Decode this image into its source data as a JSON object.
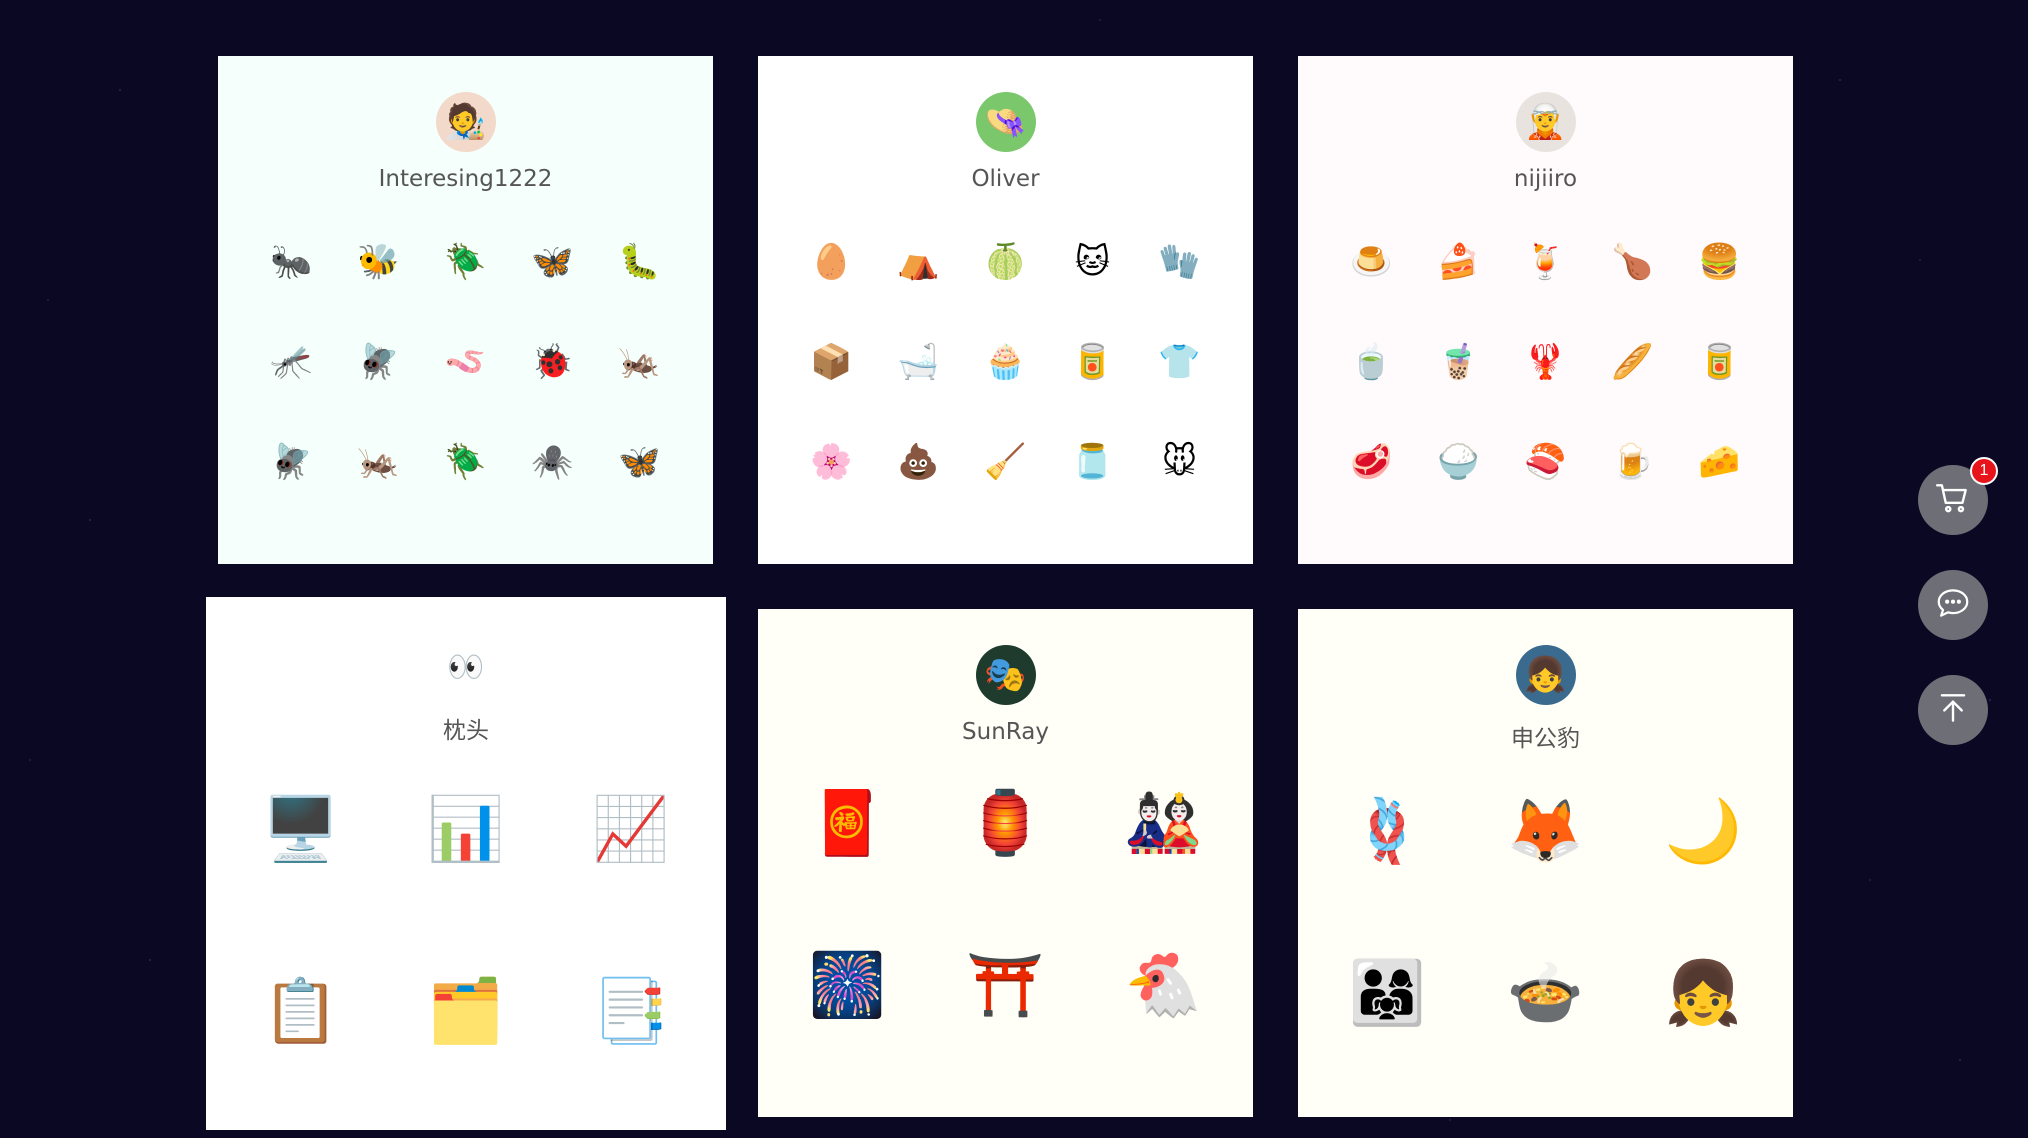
{
  "cards": [
    {
      "name": "Interesing1222",
      "avatar": "🧑‍🎨",
      "bg": "#f5fffb",
      "items": [
        "🐜",
        "🐝",
        "🪲",
        "🦋",
        "🐛",
        "🦟",
        "🪰",
        "🪱",
        "🐞",
        "🦗",
        "🪰",
        "🦗",
        "🪲",
        "🕷️",
        "🦋"
      ]
    },
    {
      "name": "Oliver",
      "avatar": "👒",
      "bg": "#ffffff",
      "items": [
        "🥚",
        "⛺",
        "🍈",
        "🐱",
        "🧤",
        "📦",
        "🛁",
        "🧁",
        "🥫",
        "👕",
        "🌸",
        "💩",
        "🧹",
        "🫙",
        "🐭"
      ]
    },
    {
      "name": "nijiiro",
      "avatar": "🧝",
      "bg": "#fffafb",
      "items": [
        "🍮",
        "🍰",
        "🍹",
        "🍗",
        "🍔",
        "🍵",
        "🧋",
        "🦞",
        "🥖",
        "🥫",
        "🥩",
        "🍚",
        "🍣",
        "🍺",
        "🧀"
      ]
    },
    {
      "name": "枕头",
      "avatar": "👀",
      "bg": "#ffffff",
      "items": [
        "🖥️",
        "📊",
        "📈",
        "📋",
        "🗂️",
        "📑"
      ]
    },
    {
      "name": "SunRay",
      "avatar": "🎭",
      "bg": "#fffff8",
      "items": [
        "🧧",
        "🏮",
        "🎎",
        "🎆",
        "⛩️",
        "🐔"
      ]
    },
    {
      "name": "申公豹",
      "avatar": "👧",
      "bg": "#fffff8",
      "items": [
        "🪢",
        "🦊",
        "🌙",
        "👨‍👩‍👧",
        "🍲",
        "👧"
      ]
    }
  ],
  "floating": {
    "cart_badge": "1"
  },
  "colors": {
    "page_bg": "#0b0823",
    "button_bg": "#6e6e76",
    "badge_bg": "#e8141b"
  },
  "icons": {
    "cart": "cart-icon",
    "chat": "chat-icon",
    "top": "back-to-top-icon"
  }
}
